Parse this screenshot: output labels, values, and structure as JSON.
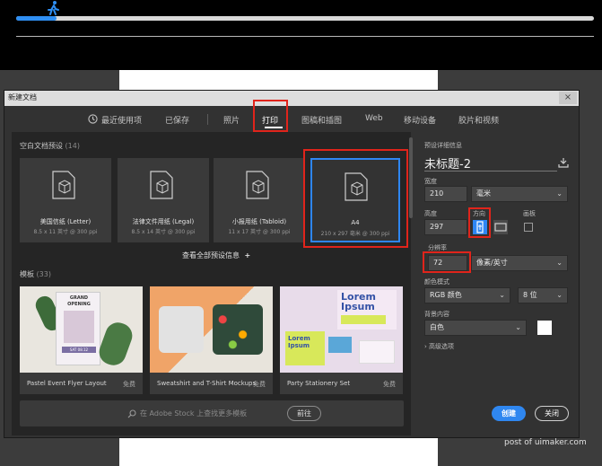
{
  "app": {
    "title": "新建文档",
    "close_glyph": "×",
    "progress_fraction": 0.07
  },
  "tabs": [
    {
      "label": "最近使用项"
    },
    {
      "label": "已保存"
    },
    {
      "label": "照片"
    },
    {
      "label": "打印"
    },
    {
      "label": "图稿和插图"
    },
    {
      "label": "Web"
    },
    {
      "label": "移动设备"
    },
    {
      "label": "胶片和视频"
    }
  ],
  "presets": {
    "heading": "空白文档预设",
    "count": "(14)",
    "items": [
      {
        "title": "美国信纸 (Letter)",
        "sub": "8.5 x 11 英寸 @ 300 ppi"
      },
      {
        "title": "法律文件用纸 (Legal)",
        "sub": "8.5 x 14 英寸 @ 300 ppi"
      },
      {
        "title": "小报用纸 (Tabloid)",
        "sub": "11 x 17 英寸 @ 300 ppi"
      },
      {
        "title": "A4",
        "sub": "210 x 297 毫米 @ 300 ppi"
      }
    ],
    "see_all": "查看全部预设信息",
    "see_all_plus": "+"
  },
  "templates": {
    "heading": "模板",
    "count": "(33)",
    "items": [
      {
        "name": "Pastel Event Flyer Layout",
        "price": "免费",
        "flyer_lines": [
          "GRAND",
          "OPENING",
          "SAT 08.12"
        ]
      },
      {
        "name": "Sweatshirt and T-Shirt Mockups",
        "price": "免费"
      },
      {
        "name": "Party Stationery Set",
        "price": "免费",
        "lorem_big": "Lorem Ipsum",
        "lorem_small": "Lorem Ipsum"
      }
    ]
  },
  "stock": {
    "placeholder": "在 Adobe Stock 上查找更多模板",
    "go_label": "前往"
  },
  "details": {
    "heading": "预设详细信息",
    "doc_name": "未标题-2",
    "width_label": "宽度",
    "width_value": "210",
    "width_unit": "毫米",
    "height_label": "高度",
    "height_value": "297",
    "orientation_label": "方向",
    "artboard_label": "画板",
    "resolution_label": "分辨率",
    "resolution_value": "72",
    "resolution_unit": "像素/英寸",
    "color_mode_label": "颜色模式",
    "color_mode_value": "RGB 颜色",
    "bit_depth_value": "8 位",
    "background_label": "背景内容",
    "background_value": "白色",
    "background_color": "#ffffff",
    "advanced_label": "高级选项",
    "create_label": "创建",
    "close_label": "关闭"
  },
  "colors": {
    "accent": "#2f87f0",
    "highlight_red": "#e0241b"
  },
  "watermark": "post of uimaker.com"
}
